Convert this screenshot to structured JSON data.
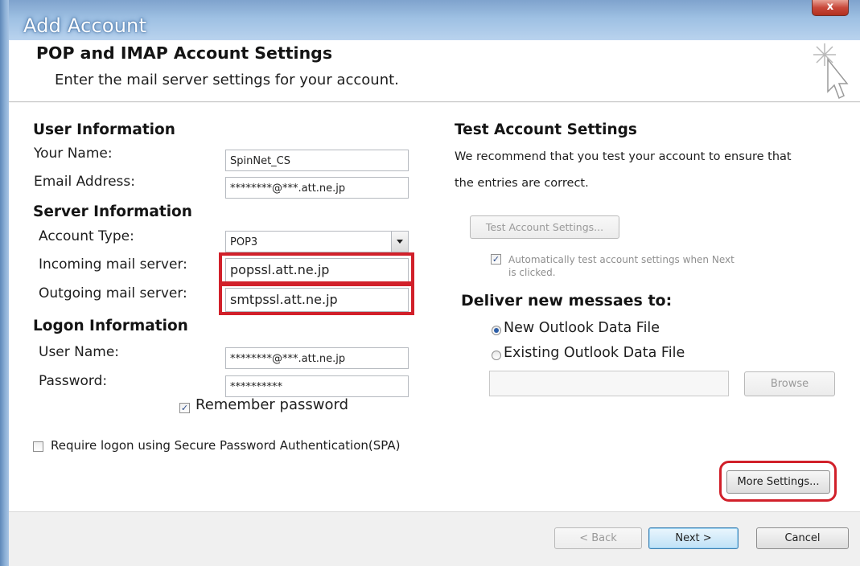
{
  "window": {
    "title": "Add Account",
    "close_symbol": "x"
  },
  "header": {
    "title": "POP and IMAP Account Settings",
    "subtitle": "Enter the mail server settings for your account."
  },
  "user_info": {
    "section": "User Information",
    "name_label": "Your Name:",
    "name_value": "SpinNet_CS",
    "email_label": "Email Address:",
    "email_value": "********@***.att.ne.jp"
  },
  "server_info": {
    "section": "Server Information",
    "account_type_label": "Account Type:",
    "account_type_value": "POP3",
    "incoming_label": "Incoming mail server:",
    "incoming_value": "popssl.att.ne.jp",
    "outgoing_label": "Outgoing mail server:",
    "outgoing_value": "smtpssl.att.ne.jp"
  },
  "logon_info": {
    "section": "Logon Information",
    "username_label": "User Name:",
    "username_value": "********@***.att.ne.jp",
    "password_label": "Password:",
    "password_value": "**********",
    "remember_label": "Remember password",
    "remember_checked": true,
    "spa_label": "Require logon using Secure Password Authentication(SPA)",
    "spa_checked": false
  },
  "test_settings": {
    "section": "Test Account Settings",
    "description_line1": "We recommend that you test your account to ensure that",
    "description_line2": "the entries are correct.",
    "test_button": "Test Account Settings...",
    "auto_test_line1": "Automatically test account settings when Next",
    "auto_test_line2": "is clicked.",
    "auto_test_checked": true
  },
  "deliver": {
    "section": "Deliver new messaes to:",
    "option_new": "New Outlook Data File",
    "option_existing": "Existing Outlook Data File",
    "selected": "new",
    "browse_button": "Browse"
  },
  "more_settings_button": "More Settings...",
  "footer": {
    "back": "< Back",
    "next": "Next >",
    "cancel": "Cancel"
  },
  "colors": {
    "highlight_red": "#d1202a",
    "title_blue": "#9ec0e3"
  }
}
